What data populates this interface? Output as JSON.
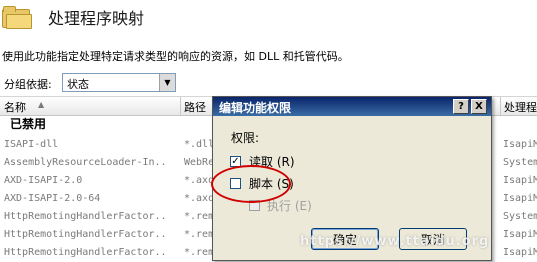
{
  "header": {
    "title": "处理程序映射",
    "description": "使用此功能指定处理特定请求类型的响应的资源，如 DLL 和托管代码。",
    "icon": "folder-icon"
  },
  "groupby": {
    "label": "分组依据:",
    "value": "状态"
  },
  "columns": {
    "name": "名称",
    "path": "路径",
    "handler": "处理程序"
  },
  "group": {
    "label": "已禁用"
  },
  "rows": [
    {
      "name": "ISAPI-dll",
      "path": "*.dll",
      "handler": "IsapiM"
    },
    {
      "name": "AssemblyResourceLoader-In...",
      "path": "WebRe",
      "handler": "System"
    },
    {
      "name": "AXD-ISAPI-2.0",
      "path": "*.axd",
      "handler": "IsapiM"
    },
    {
      "name": "AXD-ISAPI-2.0-64",
      "path": "*.axd",
      "handler": "IsapiM"
    },
    {
      "name": "HttpRemotingHandlerFactor...",
      "path": "*.rem",
      "handler": "System"
    },
    {
      "name": "HttpRemotingHandlerFactor...",
      "path": "*.rem",
      "handler": "IsapiM"
    },
    {
      "name": "HttpRemotingHandlerFactor...",
      "path": "*.rem",
      "handler": "IsapiM"
    }
  ],
  "dialog": {
    "title": "编辑功能权限",
    "help_button": "?",
    "close_button": "X",
    "permissions_label": "权限:",
    "read": {
      "label": "读取",
      "shortcut": "(R)",
      "checked": true,
      "check_mark": "✓"
    },
    "script": {
      "label": "脚本",
      "shortcut": "(S)",
      "checked": false
    },
    "execute": {
      "label": "执行",
      "shortcut": "(E)",
      "checked": false,
      "disabled": true
    },
    "ok_label": "确定",
    "cancel_label": "取消"
  },
  "watermark": "https://www.ttaidu.org",
  "colors": {
    "title_bar": "#0a246a",
    "dialog_bg": "#ece9d8",
    "annotation": "#d00000"
  }
}
